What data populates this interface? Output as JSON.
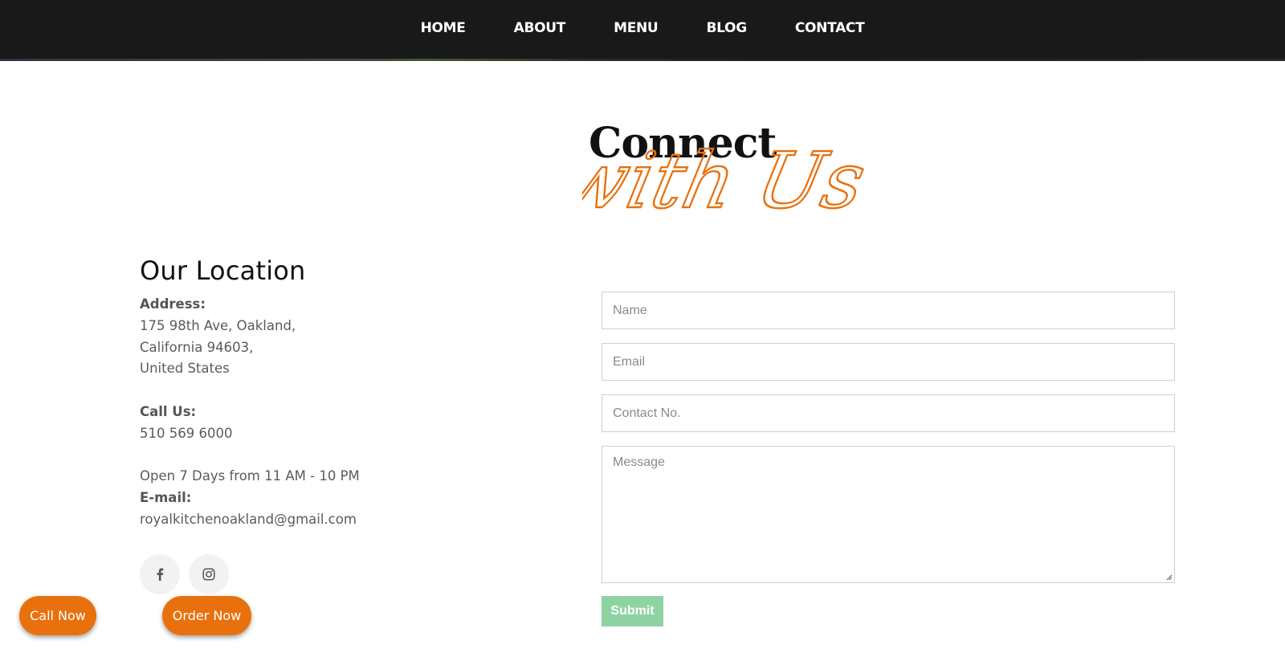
{
  "nav": {
    "items": [
      {
        "label": "HOME"
      },
      {
        "label": "ABOUT"
      },
      {
        "label": "MENU"
      },
      {
        "label": "BLOG"
      },
      {
        "label": "CONTACT"
      }
    ]
  },
  "heading": {
    "line1": "Connect",
    "line2": "with Us"
  },
  "location": {
    "title": "Our Location",
    "address_label": "Address:",
    "address_lines": [
      "175 98th Ave, Oakland,",
      "California 94603,",
      "United States"
    ],
    "call_label": "Call Us:",
    "phone": "510 569 6000",
    "hours": "Open 7 Days from 11 AM - 10 PM",
    "email_label": "E-mail:",
    "email": "royalkitchenoakland@gmail.com"
  },
  "socials": [
    {
      "icon": "facebook-icon"
    },
    {
      "icon": "instagram-icon"
    }
  ],
  "form": {
    "name_placeholder": "Name",
    "email_placeholder": "Email",
    "contact_placeholder": "Contact No.",
    "message_placeholder": "Message",
    "submit_label": "Submit"
  },
  "floating": {
    "call_label": "Call Now",
    "order_label": "Order Now"
  },
  "colors": {
    "accent": "#e8710e",
    "header_bg": "#191919",
    "submit_bg": "#8fd3a3"
  }
}
